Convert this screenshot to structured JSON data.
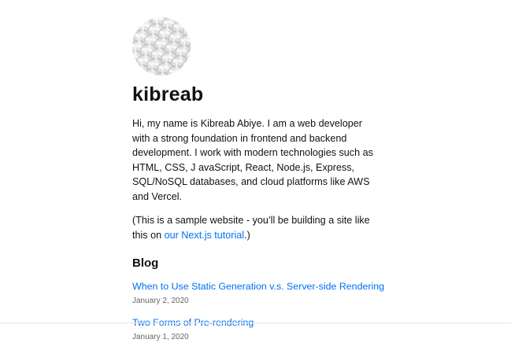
{
  "profile": {
    "avatar_icon": "profile-image-icon",
    "name": "kibreab",
    "bio": "Hi, my name is Kibreab Abiye. I am a web developer with a strong foundation in frontend and backend development. I work with modern technologies such as HTML, CSS, J avaScript, React, Node.js, Express, SQL/NoSQL databases, and cloud platforms like AWS and Vercel.",
    "note_prefix": "(This is a sample website - you’ll be building a site like this on ",
    "note_link": "our Next.js tutorial",
    "note_suffix": ".)"
  },
  "blog": {
    "heading": "Blog",
    "posts": [
      {
        "title": "When to Use Static Generation v.s. Server-side Rendering",
        "date": "January 2, 2020"
      },
      {
        "title": "Two Forms of Pre-rendering",
        "date": "January 1, 2020"
      }
    ]
  },
  "colors": {
    "link": "#0070f3",
    "text": "#111111",
    "muted": "#666666"
  }
}
